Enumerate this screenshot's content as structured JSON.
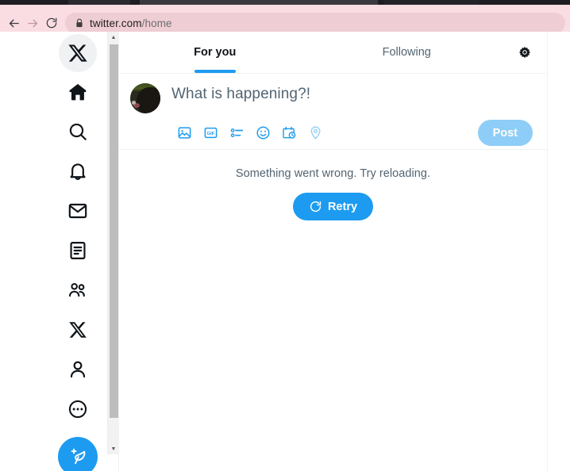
{
  "browser": {
    "back_label": "Back",
    "forward_label": "Forward",
    "reload_label": "Reload",
    "lock_icon": "lock-icon",
    "url_domain": "twitter.com",
    "url_path": "/home"
  },
  "sidebar": {
    "items": [
      {
        "name": "x-logo",
        "label": "X",
        "icon": "x-logo-icon",
        "active": true
      },
      {
        "name": "home",
        "label": "Home",
        "icon": "home-icon"
      },
      {
        "name": "explore",
        "label": "Explore",
        "icon": "search-icon"
      },
      {
        "name": "notifications",
        "label": "Notifications",
        "icon": "bell-icon"
      },
      {
        "name": "messages",
        "label": "Messages",
        "icon": "mail-icon"
      },
      {
        "name": "lists",
        "label": "Lists",
        "icon": "list-icon"
      },
      {
        "name": "communities",
        "label": "Communities",
        "icon": "people-icon"
      },
      {
        "name": "premium",
        "label": "Premium",
        "icon": "x-icon"
      },
      {
        "name": "profile",
        "label": "Profile",
        "icon": "person-icon"
      },
      {
        "name": "more",
        "label": "More",
        "icon": "more-circle-icon"
      }
    ],
    "compose": {
      "label": "Post",
      "icon": "feather-plus-icon"
    },
    "scrollbar": {
      "up": "scroll-up-arrow",
      "down": "scroll-down-arrow"
    }
  },
  "timeline": {
    "tabs": [
      {
        "label": "For you",
        "active": true
      },
      {
        "label": "Following",
        "active": false
      }
    ],
    "settings_icon": "gear-icon"
  },
  "composer": {
    "avatar": "user-avatar",
    "placeholder": "What is happening?!",
    "tools": [
      {
        "name": "media",
        "icon": "image-icon",
        "dim": false
      },
      {
        "name": "gif",
        "icon": "gif-icon",
        "dim": false
      },
      {
        "name": "poll",
        "icon": "poll-icon",
        "dim": false
      },
      {
        "name": "emoji",
        "icon": "emoji-icon",
        "dim": false
      },
      {
        "name": "schedule",
        "icon": "schedule-icon",
        "dim": false
      },
      {
        "name": "location",
        "icon": "location-pin-icon",
        "dim": true
      }
    ],
    "post_label": "Post"
  },
  "error": {
    "message": "Something went wrong. Try reloading.",
    "retry_label": "Retry",
    "retry_icon": "refresh-icon"
  },
  "colors": {
    "accent": "#1d9bf0",
    "accent_disabled": "#8ecdf7",
    "text_primary": "#0f1419",
    "text_secondary": "#536471",
    "chrome": "#fadde3",
    "urlbar": "#efcdd4",
    "border": "#eff3f4"
  }
}
